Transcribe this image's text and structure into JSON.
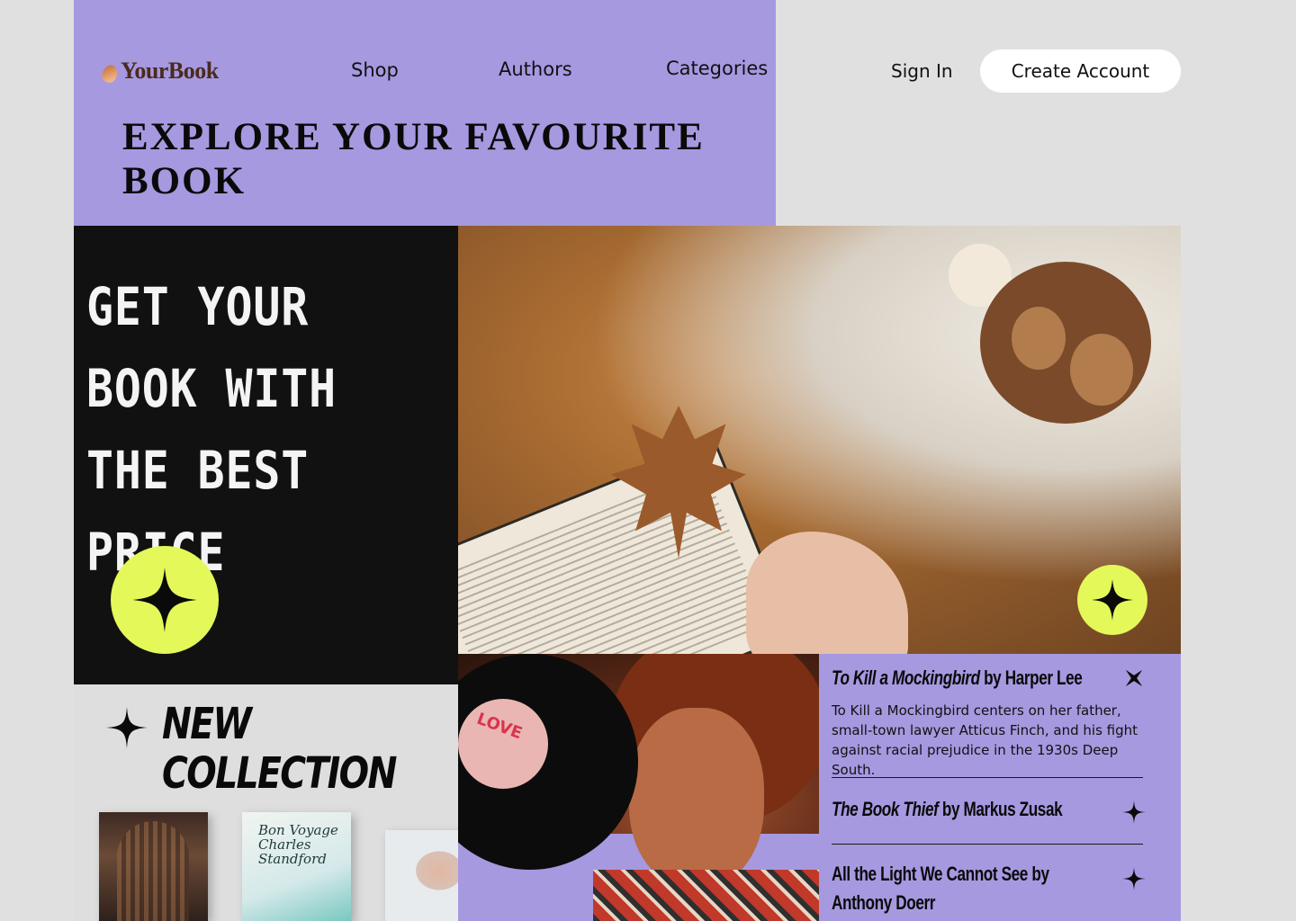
{
  "brand": {
    "name": "YourBook"
  },
  "nav": {
    "shop": "Shop",
    "authors": "Authors",
    "categories": "Categories"
  },
  "auth": {
    "sign_in": "Sign In",
    "create_account": "Create Account"
  },
  "hero": {
    "headline": "EXPLORE YOUR FAVOURITE BOOK",
    "promo": "GET YOUR BOOK WITH THE BEST PRICE"
  },
  "collection": {
    "title_line1": "NEW",
    "title_line2": "COLLECTION",
    "thumb2_text": "Bon Voyage Charles Standford"
  },
  "vinyl": {
    "label_text": "LOVE"
  },
  "books": [
    {
      "title": "To Kill a Mockingbird",
      "by": "by Harper Lee",
      "description": "To Kill a Mockingbird centers on her father, small-town lawyer Atticus Finch, and his fight against racial prejudice in the 1930s Deep South.",
      "icon": "close-star-icon"
    },
    {
      "title": "The Book Thief",
      "by": "by Markus Zusak",
      "icon": "sparkle-icon"
    },
    {
      "title": "All the Light We Cannot See",
      "by": "by Anthony Doerr",
      "icon": "sparkle-icon"
    }
  ],
  "colors": {
    "lilac": "#a699e0",
    "lime": "#e4f85a",
    "dark": "#111111",
    "background": "#e0e0e0"
  }
}
